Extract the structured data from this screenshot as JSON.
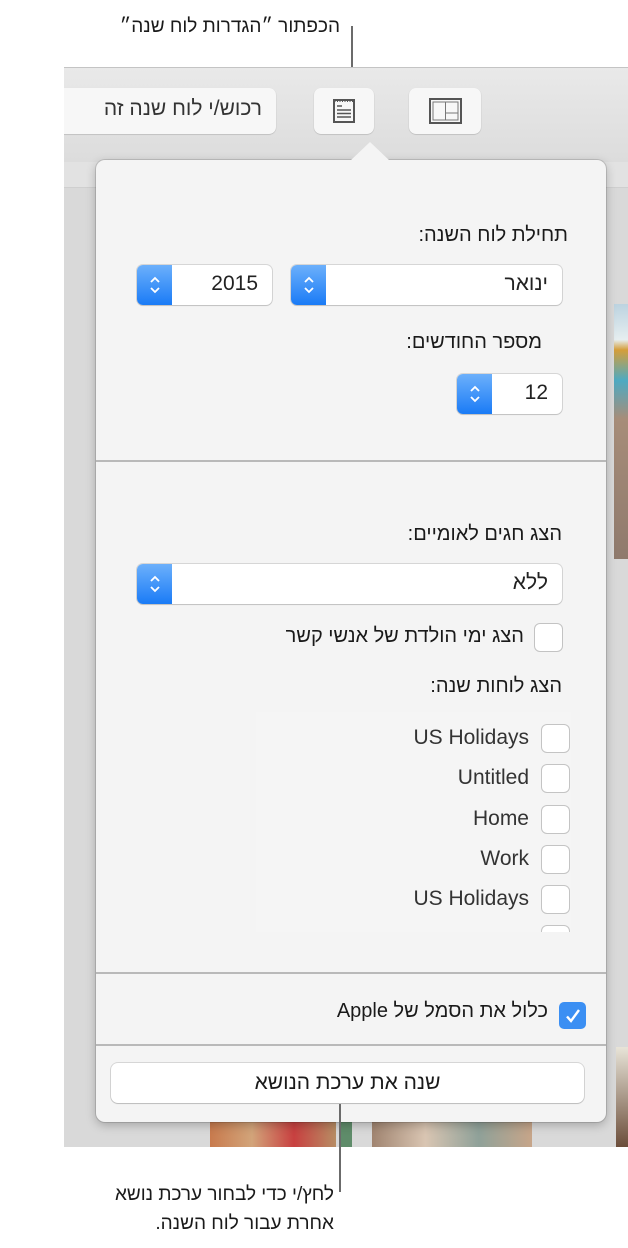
{
  "callouts": {
    "top": "הכפתור ״הגדרות לוח שנה״",
    "bottom_line1": "לחץ/י כדי לבחור ערכת נושא",
    "bottom_line2": "אחרת עבור לוח השנה."
  },
  "toolbar": {
    "print_label": "רכוש/י לוח שנה זה",
    "settings_icon": "calendar-settings-icon",
    "layout_icon": "layout-icon"
  },
  "popover": {
    "start_label": "תחילת לוח השנה:",
    "start_month": "ינואר",
    "start_year": "2015",
    "months_label": "מספר החודשים:",
    "months_value": "12",
    "holidays_label": "הצג חגים לאומיים:",
    "holidays_value": "ללא",
    "birthdays_label": "הצג ימי הולדת של אנשי קשר",
    "birthdays_checked": false,
    "calendars_label": "הצג לוחות שנה:",
    "calendars": [
      {
        "name": "US Holidays",
        "checked": false
      },
      {
        "name": "Untitled",
        "checked": false
      },
      {
        "name": "Home",
        "checked": false
      },
      {
        "name": "Work",
        "checked": false
      },
      {
        "name": "US Holidays",
        "checked": false
      }
    ],
    "apple_logo_label": "כלול את הסמל של Apple",
    "apple_logo_checked": true,
    "change_theme_label": "שנה את ערכת הנושא"
  },
  "colors": {
    "accent": "#1a7bf6",
    "checkbox_checked": "#3b8ff3"
  }
}
